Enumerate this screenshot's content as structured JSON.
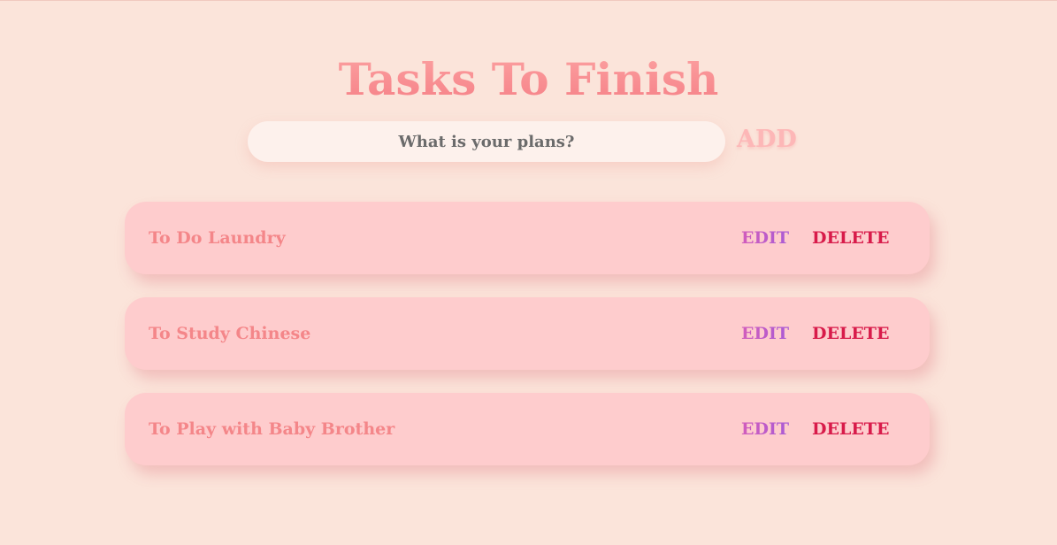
{
  "header": {
    "title": "Tasks To Finish"
  },
  "input": {
    "placeholder": "What is your plans?",
    "value": "",
    "add_label": "ADD"
  },
  "tasks": [
    {
      "text": "To Do Laundry",
      "edit_label": "EDIT",
      "delete_label": "DELETE"
    },
    {
      "text": "To Study Chinese",
      "edit_label": "EDIT",
      "delete_label": "DELETE"
    },
    {
      "text": "To Play with Baby Brother",
      "edit_label": "EDIT",
      "delete_label": "DELETE"
    }
  ],
  "colors": {
    "background": "#fbe4da",
    "title": "#fb8e8e",
    "card": "#fecccd",
    "task_text": "#f48689",
    "edit": "#c05bc9",
    "delete": "#d81b4a",
    "add": "#fdb7b7"
  }
}
